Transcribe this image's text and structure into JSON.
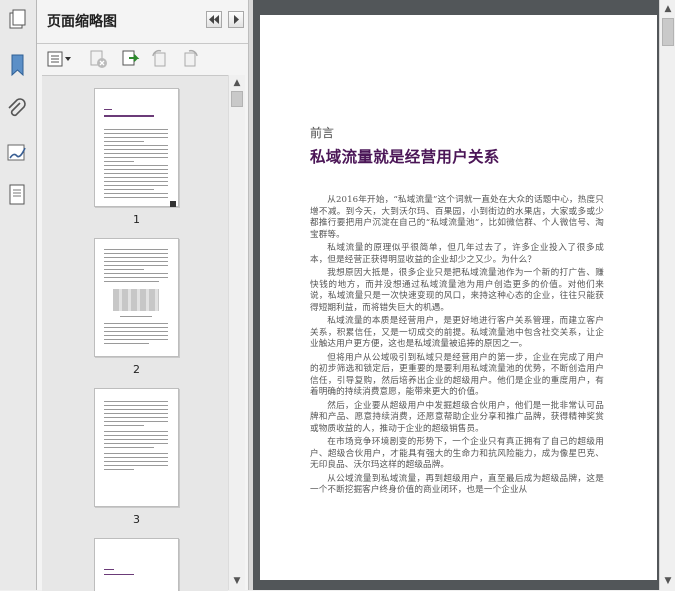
{
  "panel": {
    "title": "页面缩略图"
  },
  "thumbnails": [
    {
      "page": "1"
    },
    {
      "page": "2"
    },
    {
      "page": "3"
    }
  ],
  "document": {
    "preface_label": "前言",
    "chapter_title": "私域流量就是经营用户关系",
    "paragraphs": [
      "从2016年开始，“私域流量”这个词就一直处在大众的话题中心，热度只增不减。到今天，大到沃尔玛、百果园，小到街边的水果店，大家或多或少都推行要把用户沉淀在自己的“私域流量池”，比如微信群、个人微信号、淘宝群等。",
      "私域流量的原理似乎很简单，但几年过去了，许多企业投入了很多成本，但是经营正获得明显收益的企业却少之又少。为什么？",
      "我想原因大抵是，很多企业只是把私域流量池作为一个新的打广告、赚快钱的地方，而并没想通过私域流量池为用户创造更多的价值。对他们来说，私域流量只是一次快速变现的风口，来持这种心态的企业，往往只能获得短期利益，而将错失巨大的机遇。",
      "私域流量的本质是经营用户，是更好地进行客户关系管理，而建立客户关系，积累信任，又是一切成交的前提。私域流量池中包含社交关系，让企业触达用户更方便，这也是私域流量被追捧的原因之一。",
      "但将用户从公域吸引到私域只是经营用户的第一步，企业在完成了用户的初步筛选和锁定后，更重要的是要利用私域流量池的优势，不断创造用户信任，引导复购，然后培养出企业的超级用户。他们是企业的重度用户，有着明确的持续消费意愿，能带来更大的价值。",
      "然后，企业要从超级用户中发掘超级合伙用户，他们是一批非常认可品牌和产品、愿意持续消费，还愿意帮助企业分享和推广品牌，获得精神奖赏或物质收益的人，推动于企业的超级销售员。",
      "在市场竞争环境剧变的形势下，一个企业只有真正拥有了自己的超级用户、超级合伙用户，才能具有强大的生命力和抗风险能力，成为像星巴克、无印良品、沃尔玛这样的超级品牌。",
      "从公域流量到私域流量，再到超级用户，直至最后成为超级品牌，这是一个不断挖掘客户终身价值的商业闭环，也是一个企业从"
    ]
  }
}
